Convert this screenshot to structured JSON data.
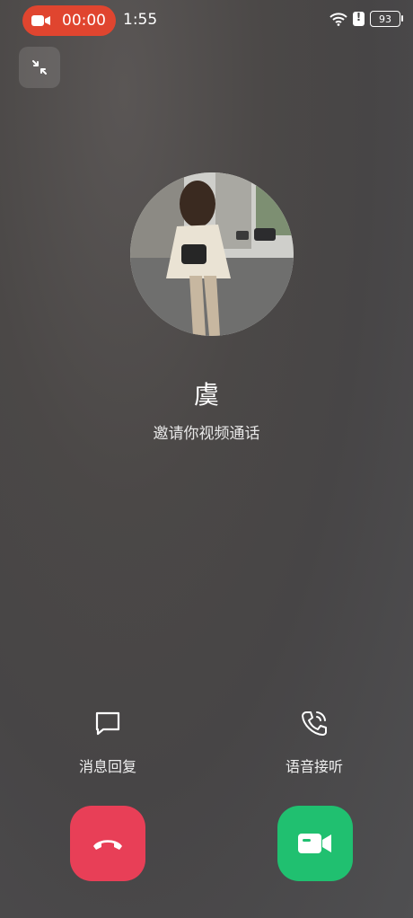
{
  "status_bar": {
    "recording_time": "00:00",
    "clock": "1:55",
    "battery": "93",
    "icons": [
      "video-camera-icon",
      "wifi-icon",
      "alert-icon",
      "battery-icon"
    ]
  },
  "call": {
    "caller_name": "虞",
    "subtitle": "邀请你视频通话"
  },
  "actions": {
    "message_reply_label": "消息回复",
    "voice_answer_label": "语音接听"
  },
  "colors": {
    "record_pill": "#e0452f",
    "decline": "#e83f57",
    "accept": "#20c070"
  }
}
